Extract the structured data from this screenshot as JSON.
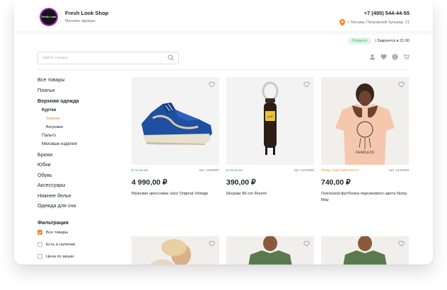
{
  "header": {
    "logo_text": "Fresh Look",
    "shop_name": "Fresh Look Shop",
    "shop_subtitle": "Магазин одежды",
    "phone": "+7 (495) 544-44-55",
    "address": "г. Москва, Петровский бульвар, 21",
    "pin_color": "#f08a24"
  },
  "status": {
    "badge": "Открыто",
    "text": "| Закроется в 21:00",
    "badge_color": "#2fb864"
  },
  "search": {
    "placeholder": "Найти товары",
    "value": ""
  },
  "toolbar": {
    "icons": [
      "user-icon",
      "heart-icon",
      "info-icon",
      "cart-icon"
    ]
  },
  "sidebar": {
    "categories": [
      {
        "label": "Все товары",
        "level": 0
      },
      {
        "label": "Платья",
        "level": 0
      },
      {
        "label": "Верхняя одежда",
        "level": 0,
        "bold": true
      },
      {
        "label": "Куртки",
        "level": 1,
        "bold": true
      },
      {
        "label": "Зимние",
        "level": 2,
        "active": true
      },
      {
        "label": "Ветровки",
        "level": 2
      },
      {
        "label": "Пальто",
        "level": 1
      },
      {
        "label": "Меховые изделия",
        "level": 1
      },
      {
        "label": "Брюки",
        "level": 0
      },
      {
        "label": "Юбки",
        "level": 0
      },
      {
        "label": "Обувь",
        "level": 0
      },
      {
        "label": "Аксессуары",
        "level": 0
      },
      {
        "label": "Нижнее белье",
        "level": 0
      },
      {
        "label": "Одежда для сна",
        "level": 0
      }
    ],
    "filter": {
      "title": "Фильтрация",
      "options": [
        {
          "label": "Все товары",
          "checked": true
        },
        {
          "label": "Есть в наличии",
          "checked": false
        },
        {
          "label": "Цена по акции",
          "checked": false
        }
      ]
    },
    "accent_color": "#f08a24"
  },
  "products": [
    {
      "availability": "В наличии",
      "article": "Арт. 1234567",
      "price": "4 990,00 ₽",
      "name": "Мужские кроссовки Jazz Original Vintage"
    },
    {
      "availability": "В наличии",
      "article": "Арт. 1244458",
      "price": "390,00 ₽",
      "name": "Шнурки 90-cm Round"
    },
    {
      "availability": "Товар скоро закончится",
      "article": "Арт. 1244458",
      "price": "740,00 ₽",
      "name": "Oversized-футболка персикового цвета Noisy May",
      "warn": true
    }
  ]
}
